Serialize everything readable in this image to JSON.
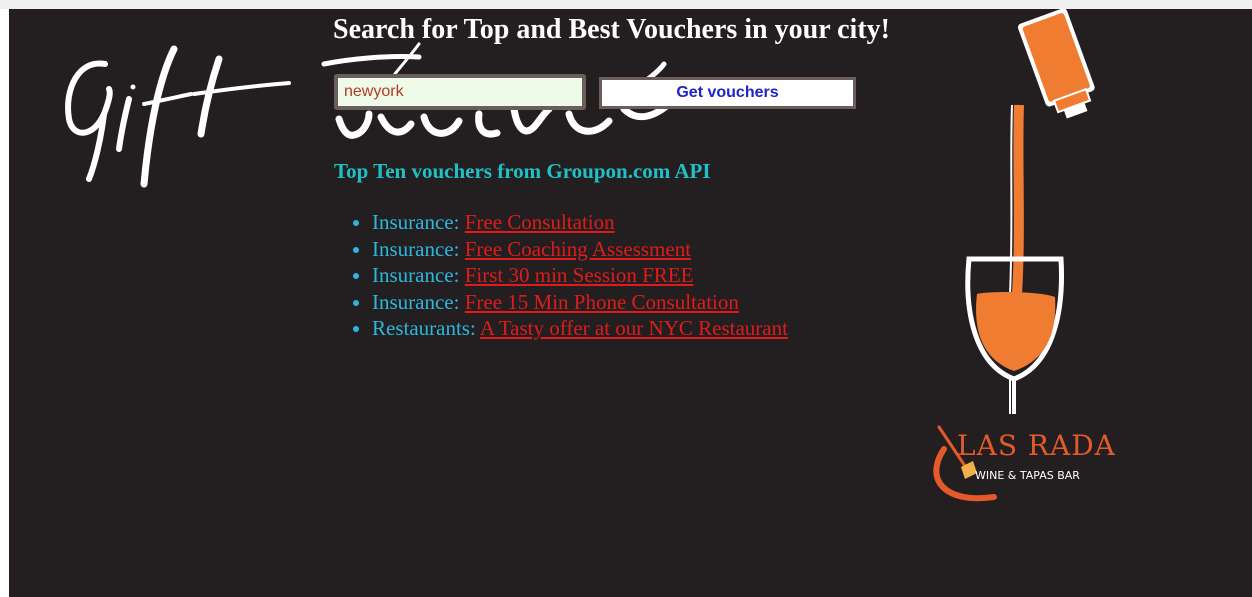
{
  "header": {
    "headline": "Search for Top and Best Vouchers in your city!"
  },
  "logo": {
    "text": "Gift Voucher",
    "icon": "gift-voucher-script-logo"
  },
  "search": {
    "value": "newyork",
    "button_label": "Get vouchers"
  },
  "results": {
    "heading": "Top Ten vouchers from Groupon.com API",
    "items": [
      {
        "category": "Insurance:",
        "title": "Free Consultation"
      },
      {
        "category": "Insurance:",
        "title": "Free Coaching Assessment"
      },
      {
        "category": "Insurance:",
        "title": "First 30 min Session FREE"
      },
      {
        "category": "Insurance:",
        "title": "Free 15 Min Phone Consultation"
      },
      {
        "category": "Restaurants:",
        "title": "A Tasty offer at our NYC Restaurant"
      }
    ]
  },
  "ad": {
    "brand": "LAS RADA",
    "tagline": "WINE & TAPAS BAR",
    "icon": "wine-bottle-glass-illustration"
  },
  "colors": {
    "page_background": "#231f20",
    "heading_cyan": "#1fc0c6",
    "list_blue": "#2ab8df",
    "link_red": "#e01b1b",
    "button_text": "#1d25c9",
    "accent_orange": "#f07c32"
  }
}
